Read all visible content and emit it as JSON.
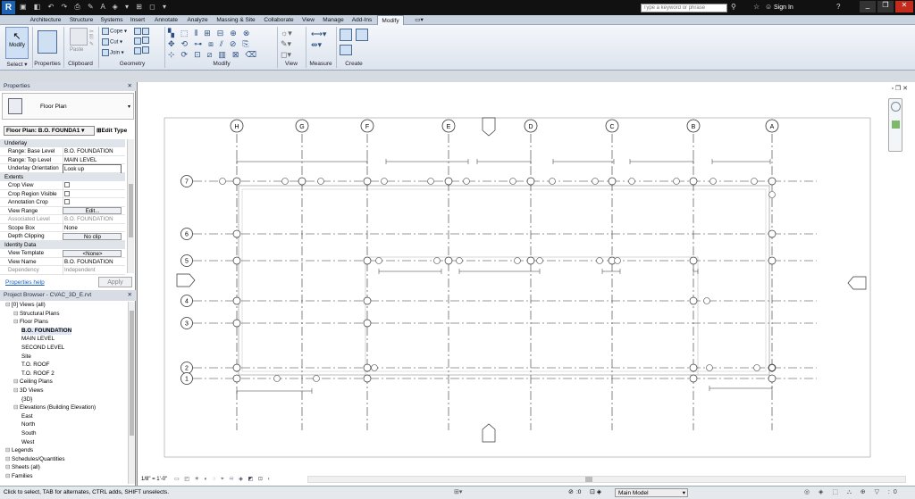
{
  "search": {
    "placeholder": "Type a keyword or phrase"
  },
  "user": {
    "sign_in": "Sign In"
  },
  "ribbon_tabs": [
    "Architecture",
    "Structure",
    "Systems",
    "Insert",
    "Annotate",
    "Analyze",
    "Massing & Site",
    "Collaborate",
    "View",
    "Manage",
    "Add-Ins",
    "Modify"
  ],
  "ribbon": {
    "modify": "Modify",
    "select": "Select ▾",
    "properties": "Properties",
    "clipboard": "Clipboard",
    "paste": "Paste",
    "cope": "Cope ▾",
    "cut": "Cut ▾",
    "join": "Join ▾",
    "geometry": "Geometry",
    "modify_panel": "Modify",
    "view": "View",
    "measure": "Measure",
    "create": "Create"
  },
  "properties": {
    "title": "Properties",
    "type_name": "Floor Plan",
    "instance_selector": "Floor Plan: B.O. FOUNDA1 ▾",
    "edit_type": "Edit Type",
    "groups": {
      "underlay": "Underlay",
      "extents": "Extents",
      "identity": "Identity Data"
    },
    "rows_underlay": [
      {
        "k": "Range: Base Level",
        "v": "B.O. FOUNDATION"
      },
      {
        "k": "Range: Top Level",
        "v": "MAIN LEVEL"
      },
      {
        "k": "Underlay Orientation",
        "v": "Look up"
      }
    ],
    "rows_extents": [
      {
        "k": "Crop View",
        "v": ""
      },
      {
        "k": "Crop Region Visible",
        "v": ""
      },
      {
        "k": "Annotation Crop",
        "v": ""
      },
      {
        "k": "View Range",
        "v": "Edit..."
      },
      {
        "k": "Associated Level",
        "v": "B.O. FOUNDATION"
      },
      {
        "k": "Scope Box",
        "v": "None"
      },
      {
        "k": "Depth Clipping",
        "v": "No clip"
      }
    ],
    "rows_identity": [
      {
        "k": "View Template",
        "v": "<None>"
      },
      {
        "k": "View Name",
        "v": "B.O. FOUNDATION"
      },
      {
        "k": "Dependency",
        "v": "Independent"
      }
    ],
    "help": "Properties help",
    "apply": "Apply"
  },
  "browser": {
    "title": "Project Browser - CVAC_3D_E.rvt",
    "items": [
      {
        "label": "[0] Views (all)",
        "indent": 0
      },
      {
        "label": "Structural Plans",
        "indent": 1
      },
      {
        "label": "Floor Plans",
        "indent": 1
      },
      {
        "label": "B.O. FOUNDATION",
        "indent": 2,
        "bold": true
      },
      {
        "label": "MAIN LEVEL",
        "indent": 2
      },
      {
        "label": "SECOND LEVEL",
        "indent": 2
      },
      {
        "label": "Site",
        "indent": 2
      },
      {
        "label": "T.O. ROOF",
        "indent": 2
      },
      {
        "label": "T.O. ROOF 2",
        "indent": 2
      },
      {
        "label": "Ceiling Plans",
        "indent": 1
      },
      {
        "label": "3D Views",
        "indent": 1
      },
      {
        "label": "{3D}",
        "indent": 2
      },
      {
        "label": "Elevations (Building Elevation)",
        "indent": 1
      },
      {
        "label": "East",
        "indent": 2
      },
      {
        "label": "North",
        "indent": 2
      },
      {
        "label": "South",
        "indent": 2
      },
      {
        "label": "West",
        "indent": 2
      },
      {
        "label": "Legends",
        "indent": 0
      },
      {
        "label": "Schedules/Quantities",
        "indent": 0
      },
      {
        "label": "Sheets (all)",
        "indent": 0
      },
      {
        "label": "Families",
        "indent": 0
      }
    ]
  },
  "grids": {
    "vertical": [
      "H",
      "G",
      "F",
      "E",
      "D",
      "C",
      "B",
      "A"
    ],
    "horizontal": [
      "7",
      "6",
      "5",
      "4",
      "3",
      "2",
      "1"
    ]
  },
  "view_controls": {
    "scale": "1/8\" = 1'-0\""
  },
  "status": {
    "hint": "Click to select, TAB for alternates, CTRL adds, SHIFT unselects.",
    "zero": ":0",
    "model": "Main Model"
  },
  "colors": {
    "accent": "#3c6fb0",
    "canvas": "#ffffff",
    "titlebar": "#111111"
  }
}
